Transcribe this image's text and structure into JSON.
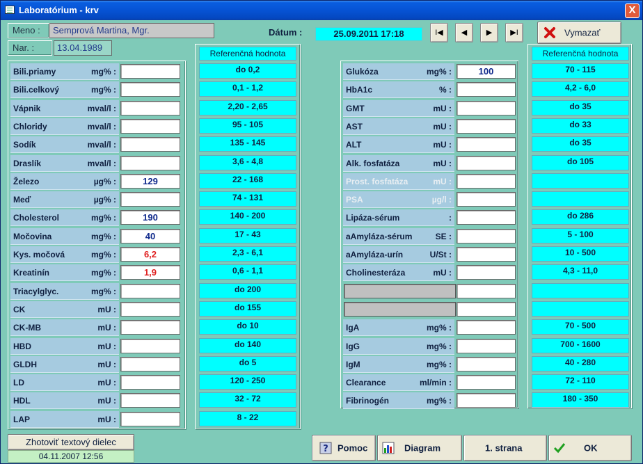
{
  "window": {
    "title": "Laboratórium - krv",
    "close_glyph": "X"
  },
  "patient": {
    "name_label": "Meno :",
    "name_value": "Semprová Martina, Mgr.",
    "birth_label": "Nar. :",
    "birth_value": "13.04.1989"
  },
  "datum": {
    "label": "Dátum :",
    "value": "25.09.2011 17:18"
  },
  "nav": {
    "first": "I◀",
    "prev": "◀",
    "next": "▶",
    "last": "▶I"
  },
  "delete_button": {
    "label": "Vymazať"
  },
  "ref_header": "Referenčná hodnota",
  "left_rows": [
    {
      "name": "Bili.priamy",
      "unit": "mg% :",
      "value": "",
      "ref": "do 0,2",
      "red": false
    },
    {
      "name": "Bili.celkový",
      "unit": "mg% :",
      "value": "",
      "ref": "0,1 - 1,2",
      "red": false
    },
    {
      "name": "Vápnik",
      "unit": "mval/l :",
      "value": "",
      "ref": "2,20 - 2,65",
      "red": false
    },
    {
      "name": "Chloridy",
      "unit": "mval/l :",
      "value": "",
      "ref": "95 - 105",
      "red": false
    },
    {
      "name": "Sodík",
      "unit": "mval/l :",
      "value": "",
      "ref": "135 - 145",
      "red": false
    },
    {
      "name": "Draslík",
      "unit": "mval/l :",
      "value": "",
      "ref": "3,6 - 4,8",
      "red": false
    },
    {
      "name": "Železo",
      "unit": "µg% :",
      "value": "129",
      "ref": "22 - 168",
      "red": false
    },
    {
      "name": "Meď",
      "unit": "µg% :",
      "value": "",
      "ref": "74 - 131",
      "red": false
    },
    {
      "name": "Cholesterol",
      "unit": "mg% :",
      "value": "190",
      "ref": "140 - 200",
      "red": false
    },
    {
      "name": "Močovina",
      "unit": "mg% :",
      "value": "40",
      "ref": "17 - 43",
      "red": false
    },
    {
      "name": "Kys. močová",
      "unit": "mg% :",
      "value": "6,2",
      "ref": "2,3 - 6,1",
      "red": true
    },
    {
      "name": "Kreatinín",
      "unit": "mg% :",
      "value": "1,9",
      "ref": "0,6 - 1,1",
      "red": true
    },
    {
      "name": "Triacylglyc.",
      "unit": "mg% :",
      "value": "",
      "ref": "do 200",
      "red": false
    },
    {
      "name": "CK",
      "unit": "mU :",
      "value": "",
      "ref": "do 155",
      "red": false
    },
    {
      "name": "CK-MB",
      "unit": "mU :",
      "value": "",
      "ref": "do 10",
      "red": false
    },
    {
      "name": "HBD",
      "unit": "mU :",
      "value": "",
      "ref": "do 140",
      "red": false
    },
    {
      "name": "GLDH",
      "unit": "mU :",
      "value": "",
      "ref": "do 5",
      "red": false
    },
    {
      "name": "LD",
      "unit": "mU :",
      "value": "",
      "ref": "120 - 250",
      "red": false
    },
    {
      "name": "HDL",
      "unit": "mU :",
      "value": "",
      "ref": "32 - 72",
      "red": false
    },
    {
      "name": "LAP",
      "unit": "mU :",
      "value": "",
      "ref": "8 - 22",
      "red": false
    }
  ],
  "right_rows": [
    {
      "name": "Glukóza",
      "unit": "mg% :",
      "value": "100",
      "ref": "70 - 115",
      "dim": false
    },
    {
      "name": "HbA1c",
      "unit": "% :",
      "value": "",
      "ref": "4,2 - 6,0",
      "dim": false
    },
    {
      "name": "GMT",
      "unit": "mU :",
      "value": "",
      "ref": "do 35",
      "dim": false
    },
    {
      "name": "AST",
      "unit": "mU :",
      "value": "",
      "ref": "do 33",
      "dim": false
    },
    {
      "name": "ALT",
      "unit": "mU :",
      "value": "",
      "ref": "do 35",
      "dim": false
    },
    {
      "name": "Alk. fosfatáza",
      "unit": "mU :",
      "value": "",
      "ref": "do 105",
      "dim": false
    },
    {
      "name": "Prost. fosfatáza",
      "unit": "mU :",
      "value": "",
      "ref": "",
      "dim": true
    },
    {
      "name": "PSA",
      "unit": "µg/l :",
      "value": "",
      "ref": "",
      "dim": true
    },
    {
      "name": "Lipáza-sérum",
      "unit": ":",
      "value": "",
      "ref": "do 286",
      "dim": false
    },
    {
      "name": "aAmyláza-sérum",
      "unit": "SE :",
      "value": "",
      "ref": "5 - 100",
      "dim": false
    },
    {
      "name": "aAmyláza-urín",
      "unit": "U/St :",
      "value": "",
      "ref": "10 - 500",
      "dim": false
    },
    {
      "name": "Cholinesteráza",
      "unit": "mU :",
      "value": "",
      "ref": "4,3 - 11,0",
      "dim": false
    },
    {
      "blank": true,
      "value": "",
      "ref": ""
    },
    {
      "blank": true,
      "value": "",
      "ref": ""
    },
    {
      "name": "IgA",
      "unit": "mg% :",
      "value": "",
      "ref": "70 - 500",
      "dim": false
    },
    {
      "name": "IgG",
      "unit": "mg% :",
      "value": "",
      "ref": "700 - 1600",
      "dim": false
    },
    {
      "name": "IgM",
      "unit": "mg% :",
      "value": "",
      "ref": "40 - 280",
      "dim": false
    },
    {
      "name": "Clearance",
      "unit": "ml/min :",
      "value": "",
      "ref": "72 - 110",
      "dim": false
    },
    {
      "name": "Fibrinogén",
      "unit": "mg% :",
      "value": "",
      "ref": "180 - 350",
      "dim": false
    }
  ],
  "text_part": {
    "button_label": "Zhotoviť textový dielec",
    "date": "04.11.2007 12:56"
  },
  "bottom": {
    "help": "Pomoc",
    "diagram": "Diagram",
    "page1": "1. strana",
    "ok": "OK"
  },
  "colors": {
    "background": "#7fcab8",
    "reference": "#00ffff",
    "label_row": "#a6cbe0",
    "out_of_range": "#e02020",
    "title_bar": "#0653d4"
  }
}
